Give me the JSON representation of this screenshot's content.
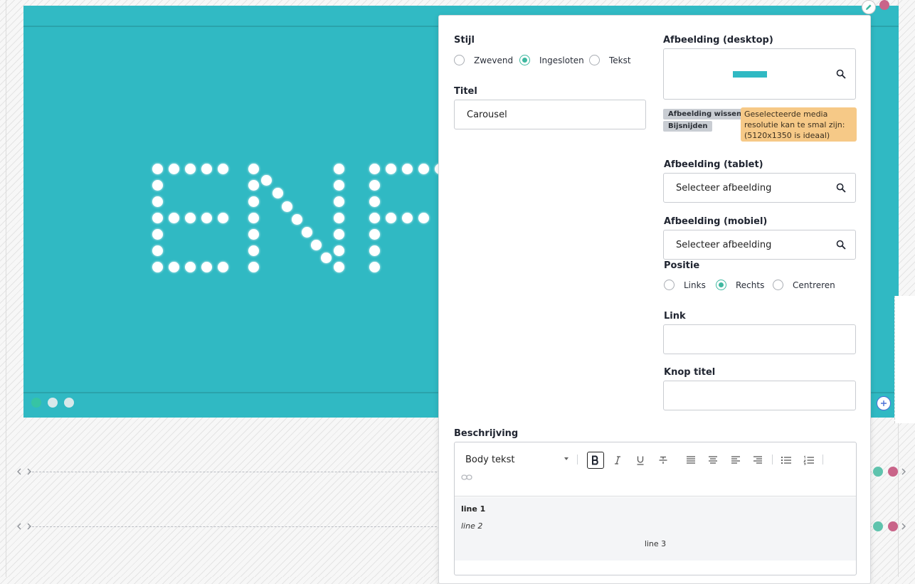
{
  "carousel": {
    "background_color": "#30b9c3",
    "indicator_count": 3,
    "active_indicator": 0
  },
  "panel": {
    "stijl": {
      "label": "Stijl",
      "options": [
        "Zwevend",
        "Ingesloten",
        "Tekst"
      ],
      "selected": "Ingesloten"
    },
    "titel": {
      "label": "Titel",
      "value": "Carousel"
    },
    "afbeelding_desktop": {
      "label": "Afbeelding (desktop)",
      "clear_button": "Afbeelding wissen",
      "crop_button": "Bijsnijden",
      "warning": "Geselecteerde media resolutie kan te smal zijn: (5120x1350 is ideaal)"
    },
    "afbeelding_tablet": {
      "label": "Afbeelding (tablet)",
      "value": "Selecteer afbeelding"
    },
    "afbeelding_mobiel": {
      "label": "Afbeelding (mobiel)",
      "value": "Selecteer afbeelding"
    },
    "positie": {
      "label": "Positie",
      "options": [
        "Links",
        "Rechts",
        "Centreren"
      ],
      "selected": "Rechts"
    },
    "link": {
      "label": "Link",
      "value": ""
    },
    "knop_titel": {
      "label": "Knop titel",
      "value": ""
    },
    "beschrijving": {
      "label": "Beschrijving",
      "format": "Body tekst",
      "lines": [
        "line 1",
        "line 2",
        "line 3"
      ]
    }
  },
  "icons": [
    "edit-icon",
    "search-icon",
    "plus-icon",
    "bold-icon",
    "italic-icon",
    "underline-icon",
    "strikethrough-icon",
    "align-justify-icon",
    "align-center-icon",
    "align-left-icon",
    "align-right-icon",
    "bullet-list-icon",
    "numbered-list-icon",
    "link-icon",
    "move-arrows-icon",
    "chevron-right-icon"
  ],
  "colors": {
    "accent": "#3fb8a0",
    "pink": "#c96489",
    "teal": "#5fc3ad",
    "warning": "#f6c987"
  }
}
